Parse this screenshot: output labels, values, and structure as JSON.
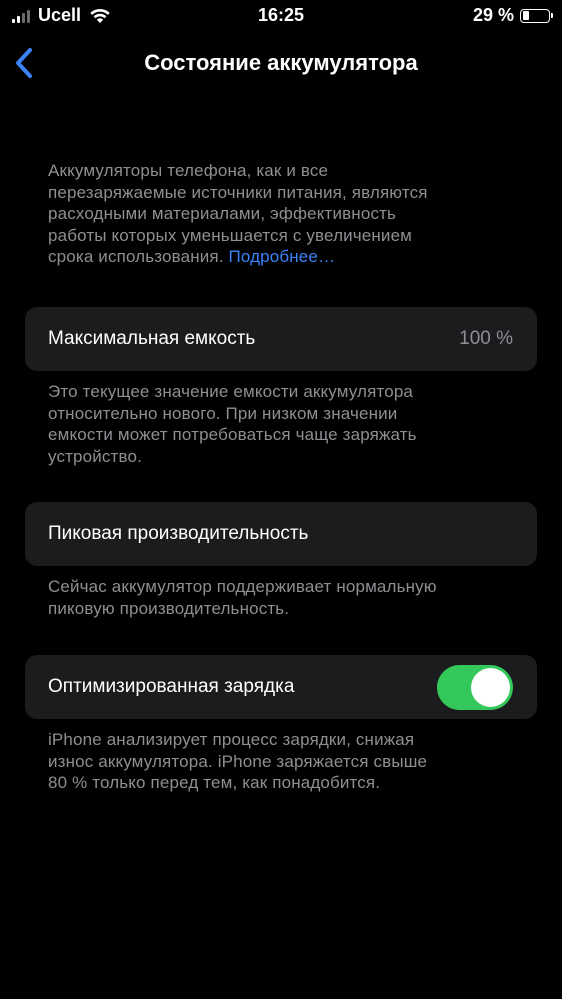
{
  "status_bar": {
    "carrier": "Ucell",
    "time": "16:25",
    "battery_text": "29 %",
    "battery_level": 0.29
  },
  "nav": {
    "title": "Состояние аккумулятора"
  },
  "intro": {
    "lines": [
      "Аккумуляторы телефона, как и все",
      "перезаряжаемые источники питания, являются",
      "расходными материалами, эффективность",
      "работы которых уменьшается с увеличением",
      "срока использования."
    ],
    "link": "Подробнее…"
  },
  "max_capacity": {
    "label": "Максимальная емкость",
    "value": "100 %",
    "footer_lines": [
      "Это текущее значение емкости аккумулятора",
      "относительно нового. При низком значении",
      "емкости может потребоваться чаще заряжать",
      "устройство."
    ]
  },
  "peak_performance": {
    "label": "Пиковая производительность",
    "footer_lines": [
      "Сейчас аккумулятор поддерживает нормальную",
      "пиковую производительность."
    ]
  },
  "optimized_charging": {
    "label": "Оптимизированная зарядка",
    "enabled": true,
    "footer_lines": [
      "iPhone анализирует процесс зарядки, снижая",
      "износ аккумулятора. iPhone заряжается свыше",
      "80 % только перед тем, как понадобится."
    ]
  },
  "colors": {
    "accent": "#3b82f6",
    "toggle_on": "#34c759",
    "cell_bg": "#1c1c1e",
    "secondary_text": "#8e8e93"
  }
}
